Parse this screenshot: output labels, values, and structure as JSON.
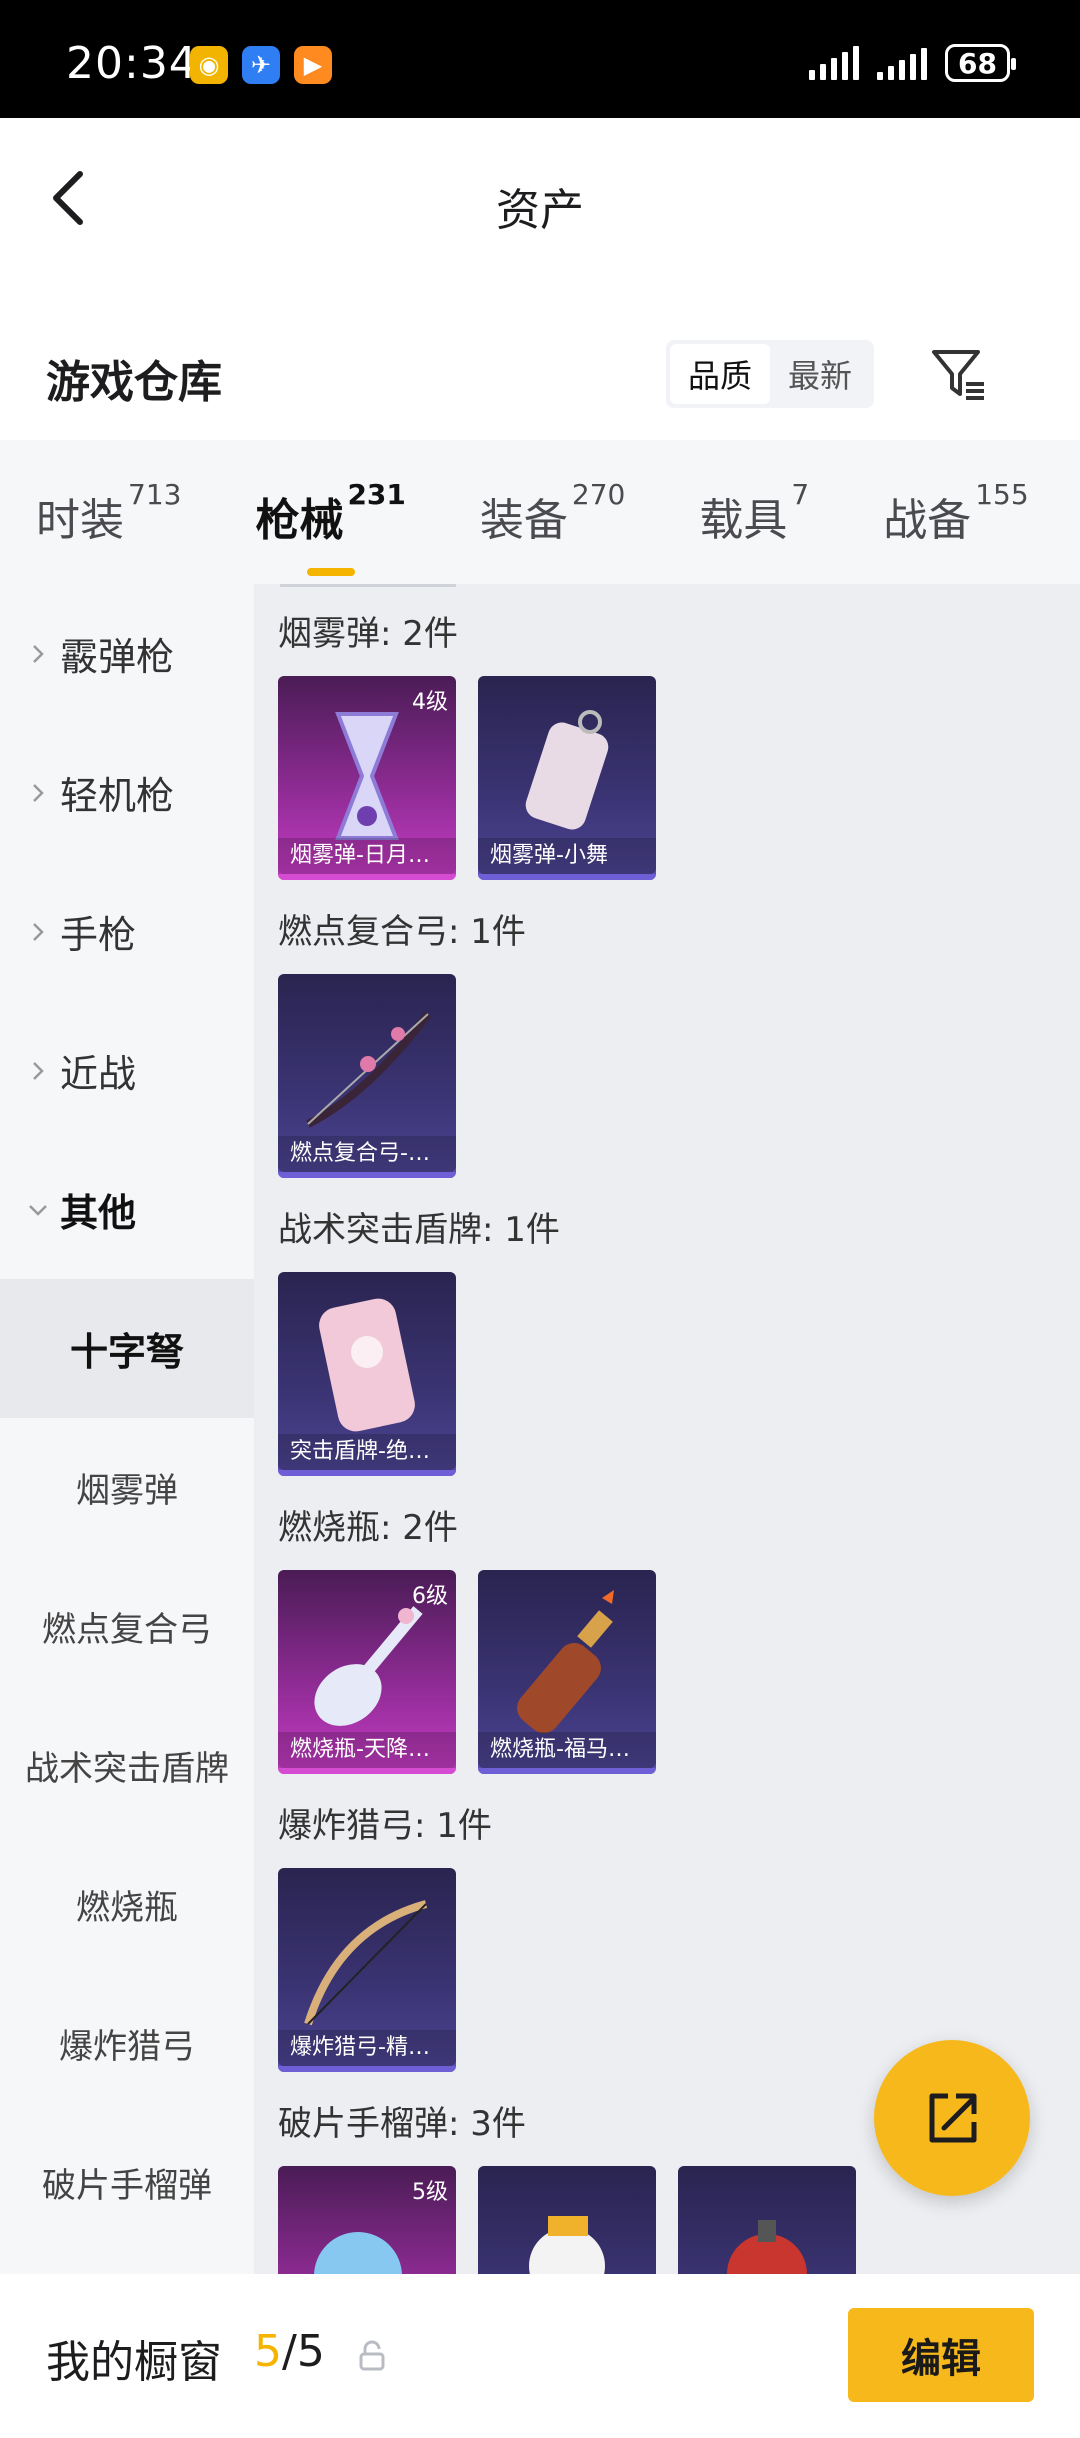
{
  "status_bar": {
    "time": "20:34",
    "battery": "68",
    "app_icons": [
      "app-icon-yellow",
      "app-icon-blue",
      "app-icon-orange"
    ]
  },
  "header": {
    "title": "资产",
    "back_icon": "back-arrow-icon"
  },
  "warehouse": {
    "title": "游戏仓库",
    "sort_options": [
      "品质",
      "最新"
    ],
    "sort_selected": "品质",
    "filter_icon": "filter-icon"
  },
  "tabs": [
    {
      "label": "时装",
      "count": "713"
    },
    {
      "label": "枪械",
      "count": "231",
      "active": true
    },
    {
      "label": "装备",
      "count": "270"
    },
    {
      "label": "载具",
      "count": "7"
    },
    {
      "label": "战备",
      "count": "155"
    }
  ],
  "sidebar": {
    "categories": [
      "霰弹枪",
      "轻机枪",
      "手枪",
      "近战",
      "其他"
    ],
    "subcategories": [
      "十字弩",
      "烟雾弹",
      "燃点复合弓",
      "战术突击盾牌",
      "燃烧瓶",
      "爆炸猎弓",
      "破片手榴弹"
    ],
    "active_sub": "十字弩"
  },
  "groups": [
    {
      "title": "烟雾弹: 2件",
      "items": [
        {
          "name": "烟雾弹-日月…",
          "level": "4级",
          "rarity": "pink"
        },
        {
          "name": "烟雾弹-小舞",
          "level": "",
          "rarity": "purple"
        }
      ]
    },
    {
      "title": "燃点复合弓: 1件",
      "items": [
        {
          "name": "燃点复合弓-…",
          "level": "",
          "rarity": "purple"
        }
      ]
    },
    {
      "title": "战术突击盾牌: 1件",
      "items": [
        {
          "name": "突击盾牌-绝…",
          "level": "",
          "rarity": "purple"
        }
      ]
    },
    {
      "title": "燃烧瓶: 2件",
      "items": [
        {
          "name": "燃烧瓶-天降…",
          "level": "6级",
          "rarity": "pink"
        },
        {
          "name": "燃烧瓶-福马…",
          "level": "",
          "rarity": "purple"
        }
      ]
    },
    {
      "title": "爆炸猎弓: 1件",
      "items": [
        {
          "name": "爆炸猎弓-精…",
          "level": "",
          "rarity": "purple"
        }
      ]
    },
    {
      "title": "破片手榴弹: 3件",
      "items": [
        {
          "name": "",
          "level": "5级",
          "rarity": "pink"
        },
        {
          "name": "",
          "level": "",
          "rarity": "purple"
        },
        {
          "name": "",
          "level": "",
          "rarity": "purple"
        }
      ]
    }
  ],
  "fab": {
    "icon": "share-icon"
  },
  "showcase": {
    "title": "我的橱窗",
    "current": "5",
    "separator": "/",
    "total": "5",
    "edit_label": "编辑",
    "lock_icon": "lock-icon"
  },
  "colors": {
    "accent": "#f7b81b",
    "rarity_pink": "#c63cc4",
    "rarity_purple": "#4e4594"
  }
}
